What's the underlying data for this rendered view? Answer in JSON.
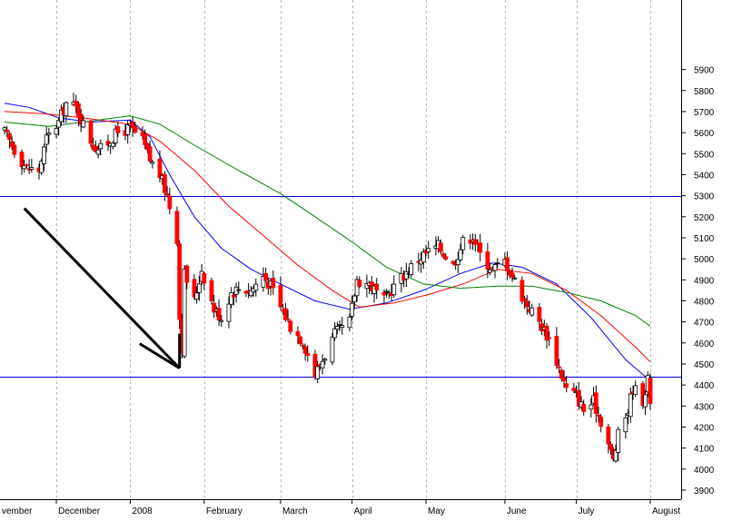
{
  "chart_data": {
    "type": "candlestick",
    "title": "",
    "xlabel": "",
    "ylabel": "",
    "ylim": [
      3850,
      5950
    ],
    "y_ticks": [
      3900,
      4000,
      4100,
      4200,
      4300,
      4400,
      4500,
      4600,
      4700,
      4800,
      4900,
      5000,
      5100,
      5200,
      5300,
      5400,
      5500,
      5600,
      5700,
      5800,
      5900
    ],
    "x_tick_labels": [
      "vember",
      "December",
      "2008",
      "February",
      "March",
      "April",
      "May",
      "June",
      "July",
      "August"
    ],
    "grid": "vertical dashed at month starts",
    "x_start": "2007-11-12",
    "x_end": "2008-07-31",
    "months": [
      {
        "label": "vember",
        "date": "2007-11-12"
      },
      {
        "label": "December",
        "date": "2007-12-03"
      },
      {
        "label": "2008",
        "date": "2008-01-02"
      },
      {
        "label": "February",
        "date": "2008-02-01"
      },
      {
        "label": "March",
        "date": "2008-03-03"
      },
      {
        "label": "April",
        "date": "2008-04-01"
      },
      {
        "label": "May",
        "date": "2008-05-01"
      },
      {
        "label": "June",
        "date": "2008-06-02"
      },
      {
        "label": "July",
        "date": "2008-07-01"
      },
      {
        "label": "August",
        "date": "2008-07-31"
      }
    ],
    "horizontal_lines": [
      {
        "value": 5300,
        "color": "#0000ff"
      },
      {
        "value": 4440,
        "color": "#0000ff"
      }
    ],
    "anchor_closes": [
      [
        "2007-11-12",
        5600
      ],
      [
        "2007-11-16",
        5520
      ],
      [
        "2007-11-21",
        5430
      ],
      [
        "2007-11-26",
        5420
      ],
      [
        "2007-11-29",
        5570
      ],
      [
        "2007-12-04",
        5650
      ],
      [
        "2007-12-07",
        5740
      ],
      [
        "2007-12-11",
        5720
      ],
      [
        "2007-12-14",
        5640
      ],
      [
        "2007-12-18",
        5540
      ],
      [
        "2007-12-21",
        5520
      ],
      [
        "2007-12-28",
        5600
      ],
      [
        "2008-01-02",
        5620
      ],
      [
        "2008-01-07",
        5560
      ],
      [
        "2008-01-10",
        5470
      ],
      [
        "2008-01-14",
        5400
      ],
      [
        "2008-01-17",
        5300
      ],
      [
        "2008-01-18",
        5250
      ],
      [
        "2008-01-21",
        5100
      ],
      [
        "2008-01-22",
        4720
      ],
      [
        "2008-01-23",
        4580
      ],
      [
        "2008-01-24",
        4930
      ],
      [
        "2008-01-28",
        4800
      ],
      [
        "2008-01-31",
        4950
      ],
      [
        "2008-02-05",
        4760
      ],
      [
        "2008-02-08",
        4720
      ],
      [
        "2008-02-12",
        4840
      ],
      [
        "2008-02-15",
        4860
      ],
      [
        "2008-02-20",
        4850
      ],
      [
        "2008-02-25",
        4920
      ],
      [
        "2008-02-28",
        4870
      ],
      [
        "2008-03-03",
        4770
      ],
      [
        "2008-03-07",
        4680
      ],
      [
        "2008-03-12",
        4610
      ],
      [
        "2008-03-17",
        4450
      ],
      [
        "2008-03-20",
        4520
      ],
      [
        "2008-03-25",
        4640
      ],
      [
        "2008-03-31",
        4700
      ],
      [
        "2008-04-03",
        4900
      ],
      [
        "2008-04-08",
        4880
      ],
      [
        "2008-04-14",
        4800
      ],
      [
        "2008-04-18",
        4870
      ],
      [
        "2008-04-24",
        4950
      ],
      [
        "2008-04-30",
        5020
      ],
      [
        "2008-05-06",
        5060
      ],
      [
        "2008-05-12",
        4970
      ],
      [
        "2008-05-16",
        5080
      ],
      [
        "2008-05-20",
        5110
      ],
      [
        "2008-05-23",
        5020
      ],
      [
        "2008-05-28",
        4950
      ],
      [
        "2008-06-02",
        4990
      ],
      [
        "2008-06-05",
        4920
      ],
      [
        "2008-06-10",
        4800
      ],
      [
        "2008-06-16",
        4700
      ],
      [
        "2008-06-20",
        4620
      ],
      [
        "2008-06-24",
        4480
      ],
      [
        "2008-06-27",
        4380
      ],
      [
        "2008-07-01",
        4350
      ],
      [
        "2008-07-04",
        4280
      ],
      [
        "2008-07-08",
        4320
      ],
      [
        "2008-07-11",
        4230
      ],
      [
        "2008-07-14",
        4120
      ],
      [
        "2008-07-16",
        4040
      ],
      [
        "2008-07-18",
        4160
      ],
      [
        "2008-07-22",
        4280
      ],
      [
        "2008-07-24",
        4390
      ],
      [
        "2008-07-28",
        4330
      ],
      [
        "2008-07-30",
        4420
      ],
      [
        "2008-07-31",
        4330
      ]
    ],
    "series": [
      {
        "line": "blue",
        "color": "#0000ff",
        "points": [
          [
            "2007-11-12",
            5740
          ],
          [
            "2007-11-22",
            5720
          ],
          [
            "2007-12-04",
            5670
          ],
          [
            "2007-12-17",
            5650
          ],
          [
            "2008-01-02",
            5660
          ],
          [
            "2008-01-10",
            5580
          ],
          [
            "2008-01-18",
            5400
          ],
          [
            "2008-01-28",
            5200
          ],
          [
            "2008-02-08",
            5050
          ],
          [
            "2008-02-20",
            4950
          ],
          [
            "2008-03-03",
            4880
          ],
          [
            "2008-03-17",
            4800
          ],
          [
            "2008-03-31",
            4760
          ],
          [
            "2008-04-15",
            4790
          ],
          [
            "2008-04-30",
            4850
          ],
          [
            "2008-05-15",
            4930
          ],
          [
            "2008-05-28",
            4980
          ],
          [
            "2008-06-09",
            4960
          ],
          [
            "2008-06-23",
            4880
          ],
          [
            "2008-07-07",
            4720
          ],
          [
            "2008-07-21",
            4520
          ],
          [
            "2008-07-31",
            4420
          ]
        ]
      },
      {
        "line": "red",
        "color": "#ff0000",
        "points": [
          [
            "2007-11-12",
            5700
          ],
          [
            "2007-11-28",
            5690
          ],
          [
            "2007-12-14",
            5670
          ],
          [
            "2008-01-02",
            5640
          ],
          [
            "2008-01-14",
            5560
          ],
          [
            "2008-01-28",
            5420
          ],
          [
            "2008-02-11",
            5250
          ],
          [
            "2008-02-25",
            5110
          ],
          [
            "2008-03-10",
            4970
          ],
          [
            "2008-03-24",
            4850
          ],
          [
            "2008-04-04",
            4770
          ],
          [
            "2008-04-18",
            4790
          ],
          [
            "2008-05-02",
            4830
          ],
          [
            "2008-05-16",
            4880
          ],
          [
            "2008-05-30",
            4950
          ],
          [
            "2008-06-13",
            4930
          ],
          [
            "2008-06-27",
            4850
          ],
          [
            "2008-07-11",
            4730
          ],
          [
            "2008-07-25",
            4580
          ],
          [
            "2008-07-31",
            4510
          ]
        ]
      },
      {
        "line": "green",
        "color": "#008000",
        "points": [
          [
            "2007-11-12",
            5650
          ],
          [
            "2007-11-30",
            5630
          ],
          [
            "2007-12-14",
            5650
          ],
          [
            "2008-01-02",
            5680
          ],
          [
            "2008-01-14",
            5640
          ],
          [
            "2008-01-28",
            5540
          ],
          [
            "2008-02-15",
            5420
          ],
          [
            "2008-03-03",
            5310
          ],
          [
            "2008-03-17",
            5200
          ],
          [
            "2008-04-01",
            5080
          ],
          [
            "2008-04-15",
            4960
          ],
          [
            "2008-04-30",
            4880
          ],
          [
            "2008-05-15",
            4860
          ],
          [
            "2008-05-30",
            4870
          ],
          [
            "2008-06-13",
            4870
          ],
          [
            "2008-06-27",
            4840
          ],
          [
            "2008-07-11",
            4800
          ],
          [
            "2008-07-25",
            4730
          ],
          [
            "2008-07-31",
            4680
          ]
        ]
      }
    ],
    "arrow": {
      "from": [
        "2007-11-20",
        5240
      ],
      "to": [
        "2008-01-22",
        4480
      ],
      "color": "#000000"
    }
  },
  "colors": {
    "background": "#ffffff",
    "up_candle": "#ffffff",
    "down_candle": "#ff0000",
    "wick": "#000000",
    "grid": "#bbbbbb",
    "axis": "#000000"
  }
}
